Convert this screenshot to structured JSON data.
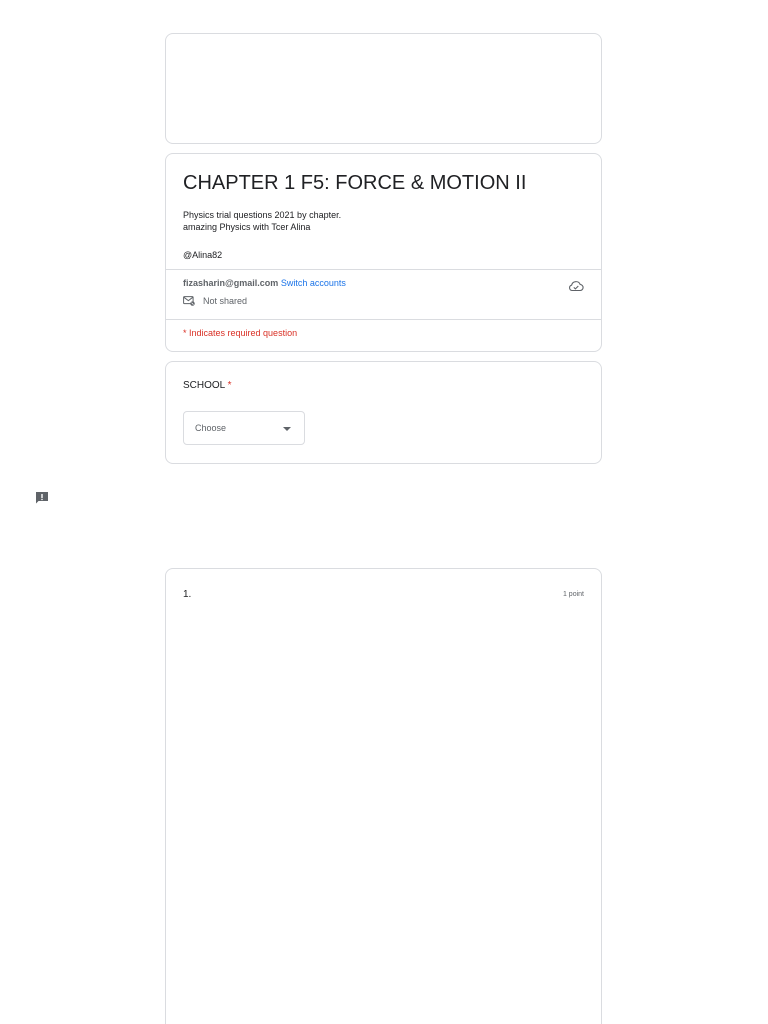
{
  "form": {
    "title": "CHAPTER 1 F5: FORCE & MOTION II",
    "description_line1": "Physics trial questions 2021 by chapter.",
    "description_line2": "amazing Physics with Tcer Alina",
    "author": "@Alina82"
  },
  "account": {
    "email": "fizasharin@gmail.com",
    "switch_label": "Switch accounts",
    "shared_status": "Not shared",
    "cloud_icon": "cloud-saved-icon",
    "mail_icon": "mail-not-shared-icon"
  },
  "required_note": "* Indicates required question",
  "school_question": {
    "label": "SCHOOL",
    "required_marker": "*",
    "dropdown_value": "Choose"
  },
  "report_icon": "report-issue-icon",
  "question1": {
    "number": "1.",
    "points": "1 point"
  },
  "colors": {
    "border": "#dadce0",
    "link": "#1a73e8",
    "required": "#d93025",
    "muted_text": "#5f6368"
  }
}
